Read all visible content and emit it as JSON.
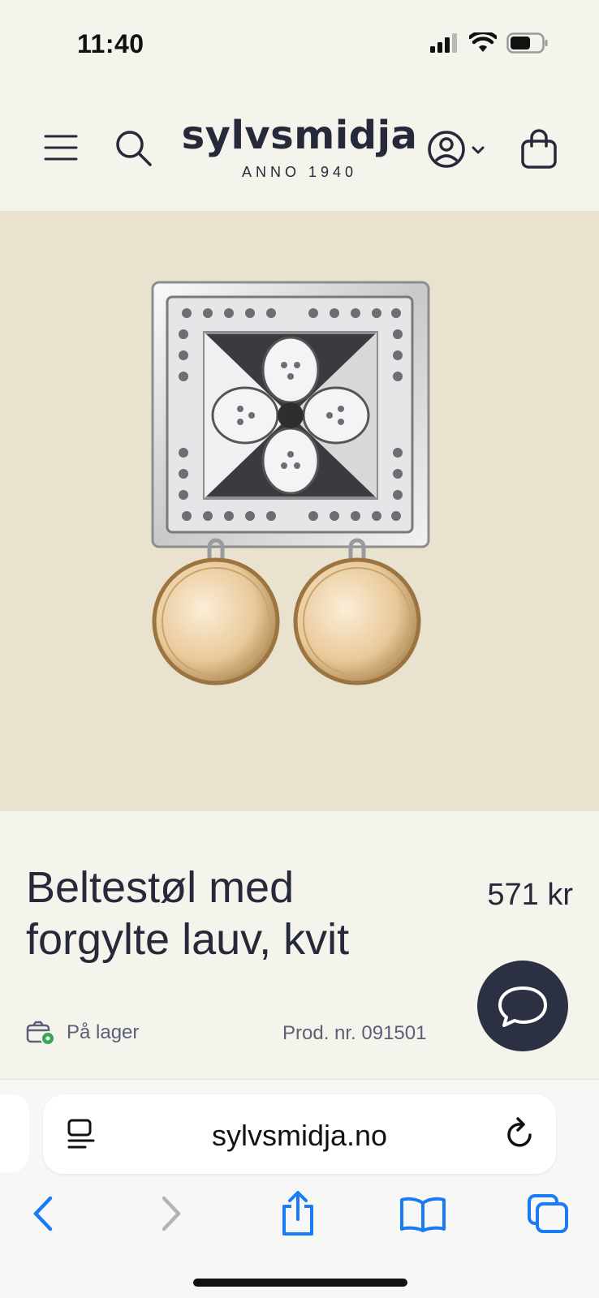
{
  "status_bar": {
    "time": "11:40",
    "icons": [
      "cellular-signal-icon",
      "wifi-icon",
      "battery-icon"
    ]
  },
  "header": {
    "logo_name": "sylvsmidja",
    "logo_tagline": "ANNO 1940",
    "icons": [
      "menu-icon",
      "search-icon",
      "account-icon",
      "chevron-down-icon",
      "shopping-bag-icon"
    ]
  },
  "product": {
    "title": "Beltestøl med forgylte lauv, kvit",
    "price": "571 kr",
    "stock_label": "På lager",
    "product_number": "Prod. nr. 091501"
  },
  "browser": {
    "url": "sylvsmidja.no",
    "nav_icons": [
      "back-icon",
      "forward-icon",
      "share-icon",
      "bookmarks-icon",
      "tabs-icon"
    ]
  },
  "colors": {
    "background": "#f4f3ec",
    "hero_background": "#e9e2cf",
    "text_primary": "#26293a",
    "chat_button": "#2b3142",
    "ios_blue": "#1a7cf5",
    "stock_green": "#3aa757"
  }
}
